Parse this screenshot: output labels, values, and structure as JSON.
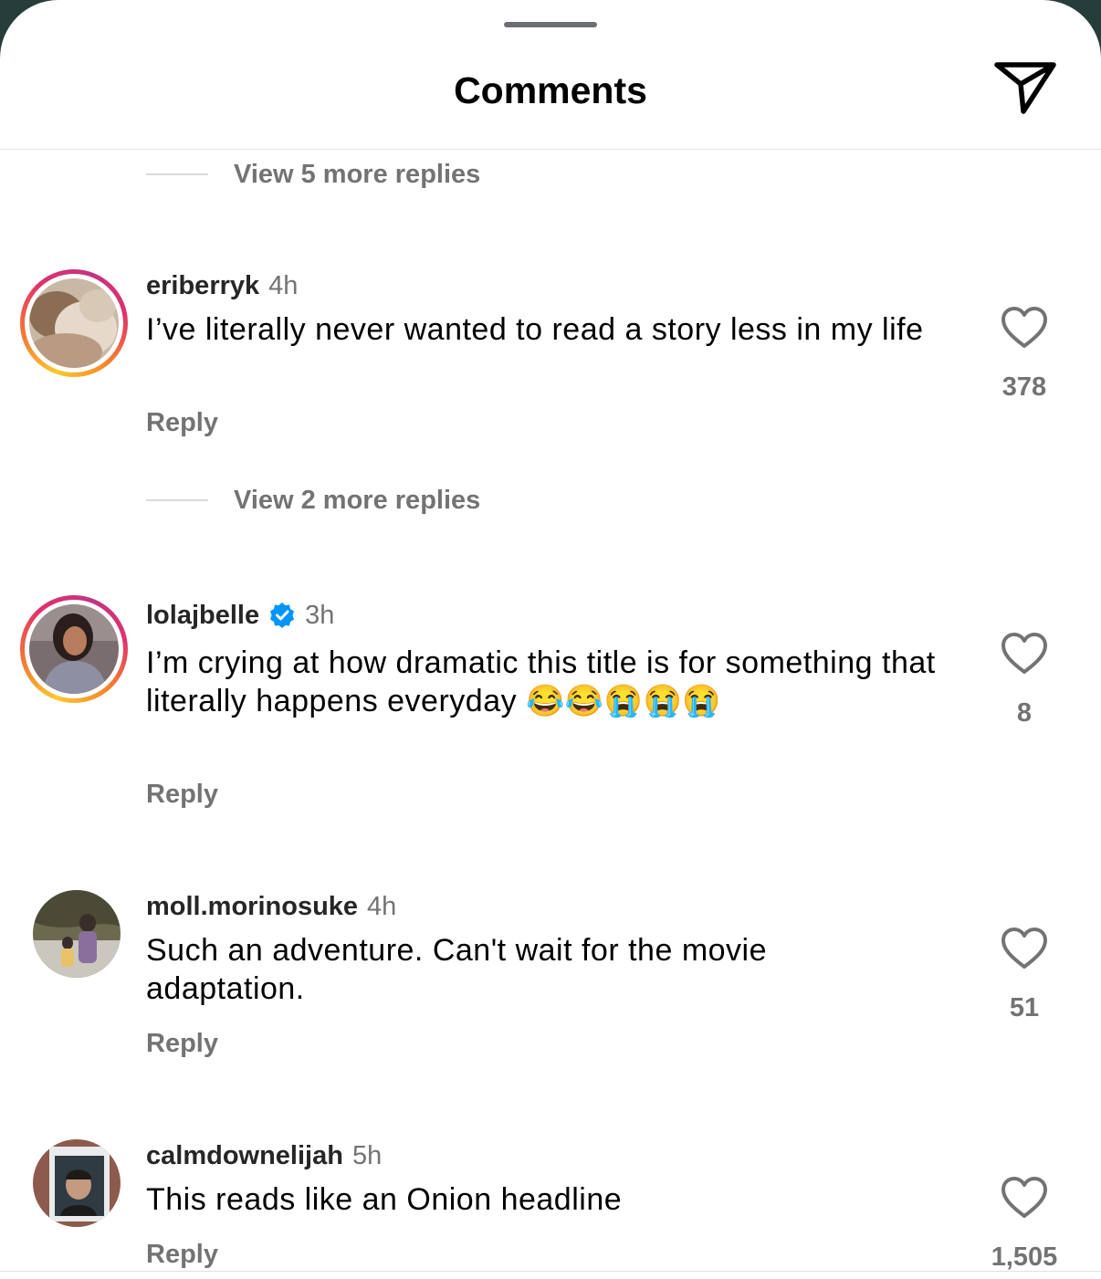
{
  "header": {
    "title": "Comments",
    "send_icon": "paper-plane-icon"
  },
  "view_replies": [
    {
      "label": "View 5 more replies"
    },
    {
      "label": "View 2 more replies"
    }
  ],
  "comments": [
    {
      "username": "eriberryk",
      "time": "4h",
      "verified": false,
      "text": "I’ve literally never wanted to read a story less in my life",
      "reply_label": "Reply",
      "likes": "378"
    },
    {
      "username": "lolajbelle",
      "time": "3h",
      "verified": true,
      "text": "I’m crying at how dramatic this title is for something that literally happens everyday",
      "emojis": "😂😂😭😭😭",
      "reply_label": "Reply",
      "likes": "8"
    },
    {
      "username": "moll.morinosuke",
      "time": "4h",
      "verified": false,
      "text": "Such an adventure. Can't wait for the movie adaptation.",
      "reply_label": "Reply",
      "likes": "51"
    },
    {
      "username": "calmdownelijah",
      "time": "5h",
      "verified": false,
      "text": "This reads like an Onion headline",
      "reply_label": "Reply",
      "likes": "1,505"
    }
  ],
  "colors": {
    "muted": "#737373",
    "text": "#262626",
    "verified": "#0095f6"
  }
}
